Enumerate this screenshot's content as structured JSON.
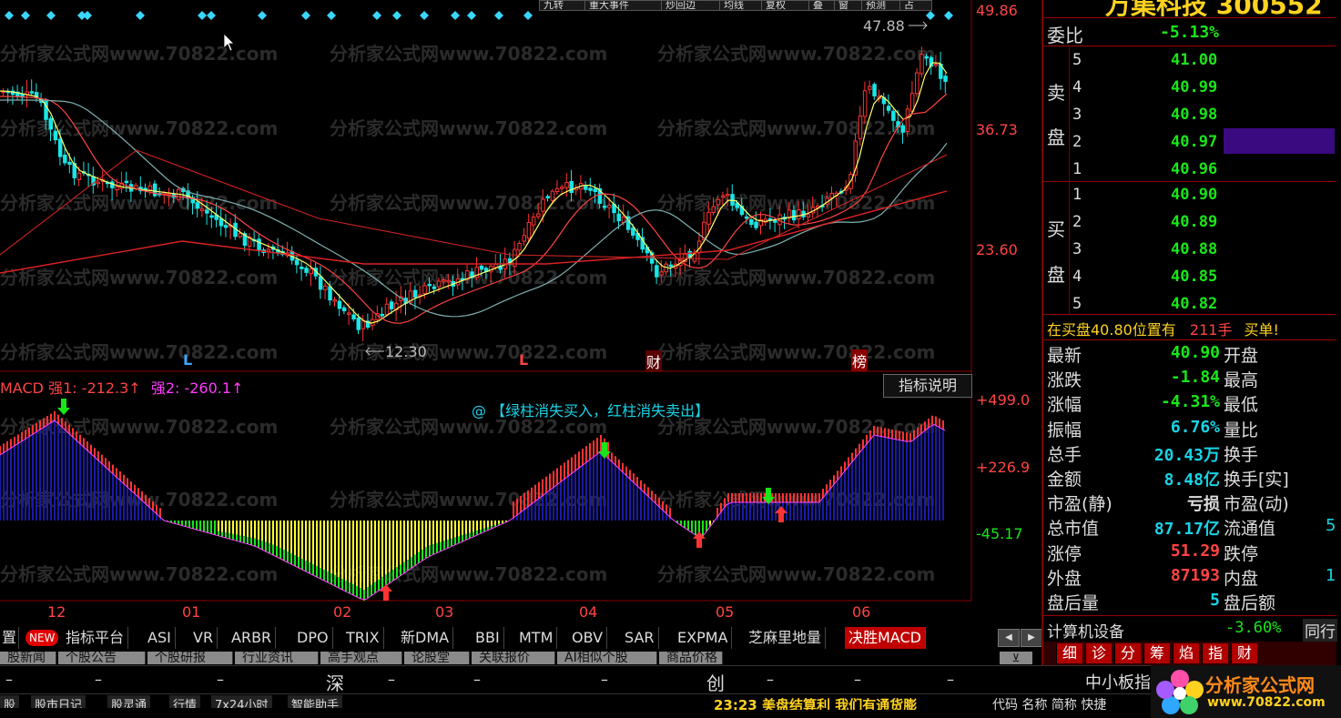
{
  "toolbar": {
    "buttons": [
      "九转",
      "重大事件",
      "炒回边",
      "均线",
      "复权",
      "叠",
      "窗",
      "预测",
      "占"
    ]
  },
  "price_chart": {
    "y_labels": [
      "49.86",
      "36.73",
      "23.60"
    ],
    "high_label": "47.88",
    "low_label": "12.30",
    "markers": [
      {
        "text": "L",
        "color": "#3fa7ff"
      },
      {
        "text": "L",
        "color": "#ff4444"
      },
      {
        "text": "财",
        "color": "#ffffff"
      },
      {
        "text": "榜",
        "color": "#ffffff"
      }
    ],
    "watermark": "分析家公式网www.70822.com"
  },
  "macd_chart": {
    "title_prefix": "MACD",
    "strength1_label": "强1: -212.3↑",
    "strength2_label": "强2: -260.1↑",
    "hint_icon": "@",
    "hint": "【绿柱消失买入，红柱消失卖出】",
    "explain_button": "指标说明",
    "y_labels": [
      "+499.0",
      "+226.9",
      "-45.17"
    ]
  },
  "x_axis": [
    "12",
    "01",
    "02",
    "03",
    "04",
    "05",
    "06"
  ],
  "indicator_tabs": {
    "new_badge": "NEW",
    "first_partial": "置",
    "items": [
      "指标平台",
      "ASI",
      "VR",
      "ARBR",
      "DPO",
      "TRIX",
      "新DMA",
      "BBI",
      "MTM",
      "OBV",
      "SAR",
      "EXPMA",
      "芝麻里地量",
      "决胜MACD"
    ],
    "active": "决胜MACD"
  },
  "nav_tabs": [
    "股新闻",
    "个股公告",
    "个股研报",
    "行业资讯",
    "高手观点",
    "论股堂",
    "关联报价",
    "AI相似个股",
    "商品价格"
  ],
  "ticker": {
    "left_dash": "–",
    "market1": "深",
    "market2": "创",
    "market3": "中小板指"
  },
  "status_bar": {
    "items": [
      "股",
      "股市日记",
      "股灵通",
      "行情",
      "7x24小时",
      "智能助手"
    ],
    "scrolling": "23:23 美盘结算利 我们有通货膨",
    "right_text": "代码 名称 简称 快捷"
  },
  "logo": {
    "title": "分析家公式网",
    "url": "www.70822.com"
  },
  "quote": {
    "header_partial": "万集科技 300552",
    "wei_bi_label": "委比",
    "wei_bi_value": "-5.13%",
    "sell_label": [
      "卖",
      "盘"
    ],
    "buy_label": [
      "买",
      "盘"
    ],
    "sell_levels": [
      {
        "level": "5",
        "price": "41.00"
      },
      {
        "level": "4",
        "price": "40.99"
      },
      {
        "level": "3",
        "price": "40.98"
      },
      {
        "level": "2",
        "price": "40.97"
      },
      {
        "level": "1",
        "price": "40.96"
      }
    ],
    "buy_levels": [
      {
        "level": "1",
        "price": "40.90"
      },
      {
        "level": "2",
        "price": "40.89"
      },
      {
        "level": "3",
        "price": "40.88"
      },
      {
        "level": "4",
        "price": "40.85"
      },
      {
        "level": "5",
        "price": "40.82"
      }
    ],
    "alert_prefix": "在买盘40.80位置有",
    "alert_volume": "211手",
    "alert_suffix": "买单!",
    "stats": [
      {
        "label": "最新",
        "value": "40.90",
        "color": "#19e619",
        "right": "开盘"
      },
      {
        "label": "涨跌",
        "value": "-1.84",
        "color": "#19e619",
        "right": "最高"
      },
      {
        "label": "涨幅",
        "value": "-4.31%",
        "color": "#19e619",
        "right": "最低"
      },
      {
        "label": "振幅",
        "value": "6.76%",
        "color": "#19d3e6",
        "right": "量比"
      },
      {
        "label": "总手",
        "value": "20.43万",
        "color": "#19d3e6",
        "right": "换手"
      },
      {
        "label": "金额",
        "value": "8.48亿",
        "color": "#19d3e6",
        "right": "换手[实]"
      },
      {
        "label": "市盈(静)",
        "value": "亏损",
        "color": "#dddddd",
        "right": "市盈(动)"
      },
      {
        "label": "总市值",
        "value": "87.17亿",
        "color": "#19d3e6",
        "right": "流通值"
      },
      {
        "label": "涨停",
        "value": "51.29",
        "color": "#ff4444",
        "right": "跌停"
      },
      {
        "label": "外盘",
        "value": "87193",
        "color": "#ff4444",
        "right": "内盘"
      },
      {
        "label": "盘后量",
        "value": "5",
        "color": "#19d3e6",
        "right": "盘后额"
      }
    ],
    "right_edge_values": [
      "5",
      "1"
    ],
    "sector_name": "计算机设备",
    "sector_change": "-3.60%",
    "sector_more": "同行",
    "bottom_tabs": [
      "细",
      "诊",
      "分",
      "筹",
      "焰",
      "指",
      "财"
    ]
  },
  "colors": {
    "up": "#ff3333",
    "down": "#19e6e6",
    "green": "#19e619",
    "grid": "#800000",
    "blue_bar": "#1a1aa6",
    "yellow_bar": "#ffff33",
    "purple_highlight": "#3a0a80"
  }
}
